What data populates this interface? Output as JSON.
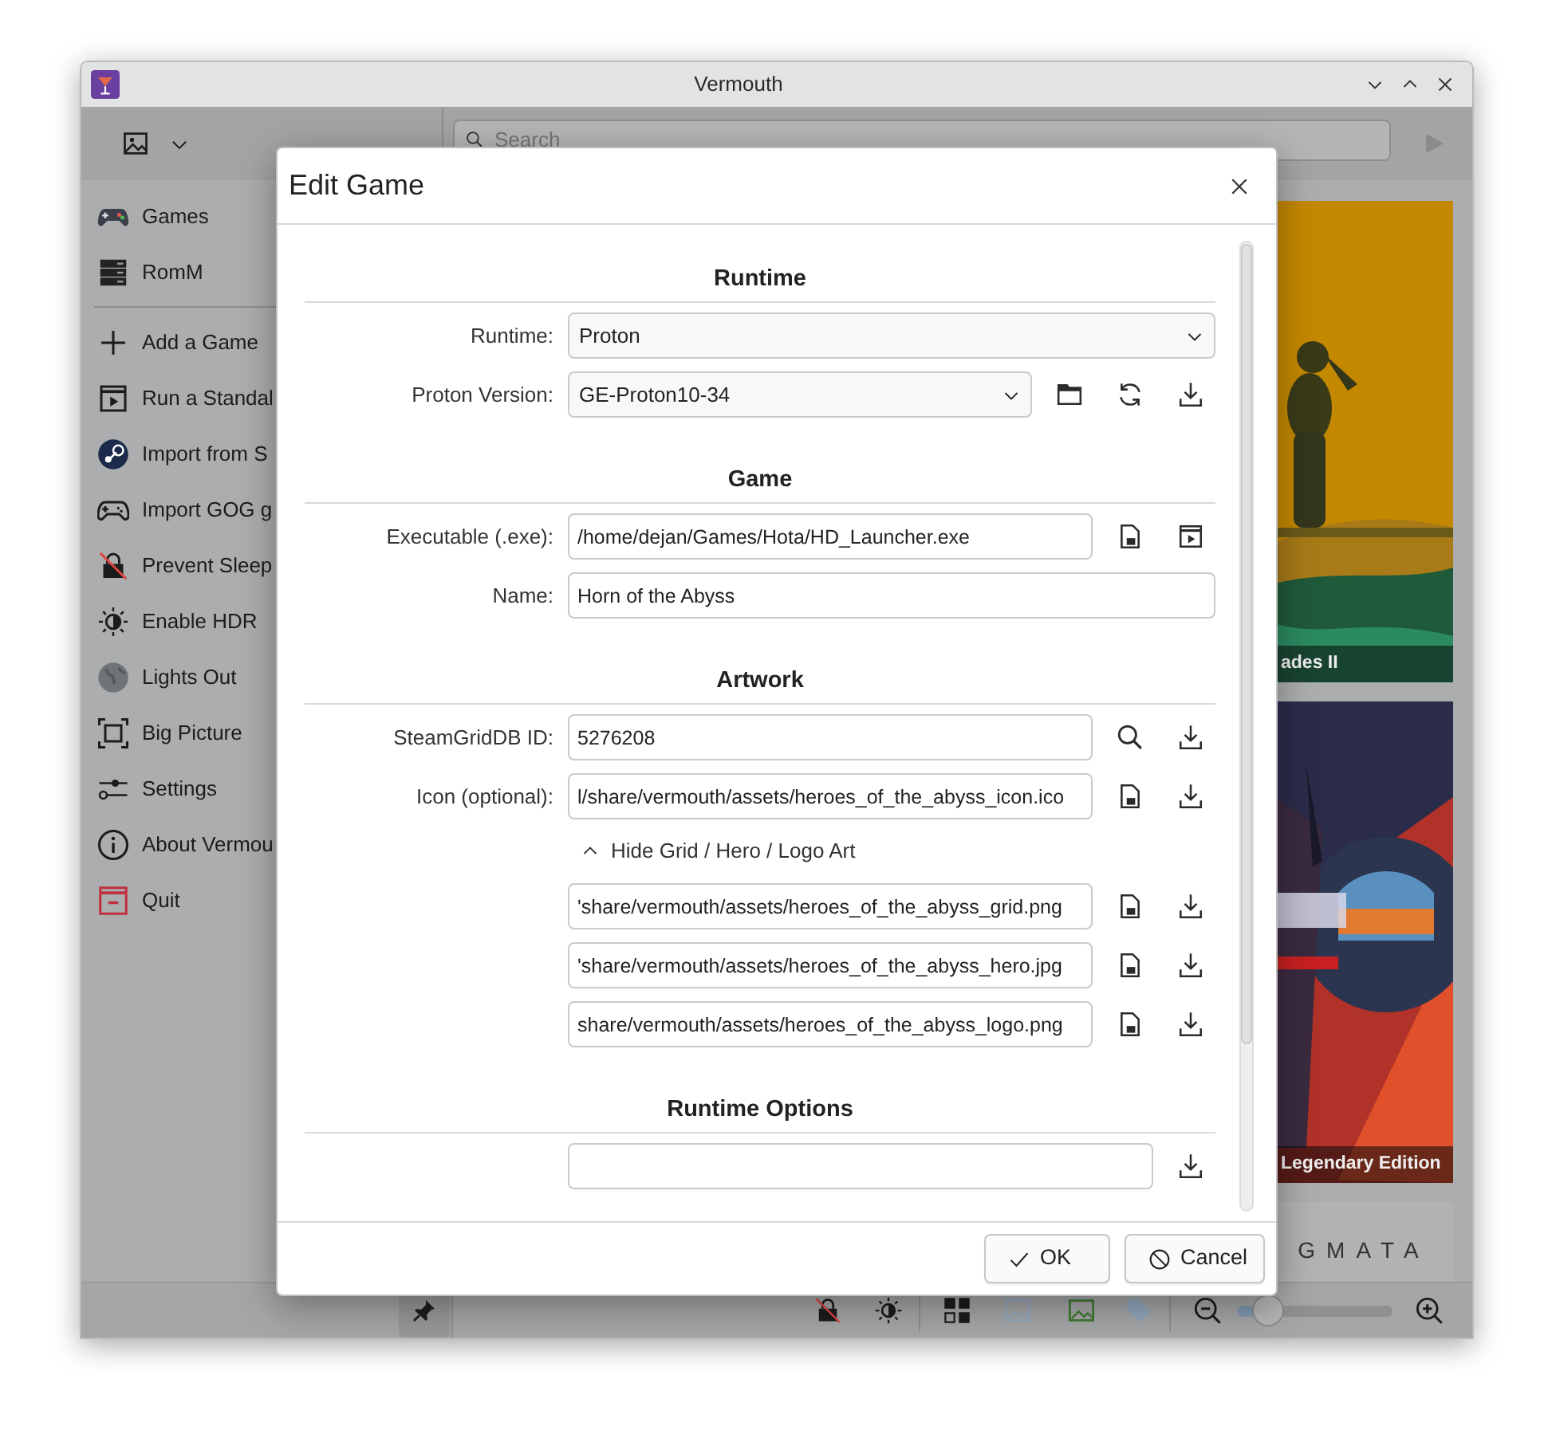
{
  "window": {
    "title": "Vermouth"
  },
  "toolbar": {
    "search": {
      "placeholder": "Search"
    }
  },
  "sidebar": {
    "groups": [
      [
        {
          "label": "Games"
        },
        {
          "label": "RomM"
        }
      ],
      [
        {
          "label": "Add a Game"
        },
        {
          "label": "Run a Standal"
        },
        {
          "label": "Import from S"
        },
        {
          "label": "Import GOG g"
        },
        {
          "label": "Prevent Sleep"
        },
        {
          "label": "Enable HDR"
        },
        {
          "label": "Lights Out"
        },
        {
          "label": "Big Picture"
        },
        {
          "label": "Settings"
        },
        {
          "label": "About Vermou"
        },
        {
          "label": "Quit"
        }
      ]
    ]
  },
  "library": {
    "covers": [
      {
        "kind": "picture",
        "caption": "ades II"
      },
      {
        "kind": "picture",
        "caption": "Legendary Edition"
      },
      {
        "kind": "text",
        "title": "GMATA"
      }
    ]
  },
  "bottom_bar": {
    "zoom": {
      "level": 0.2
    }
  },
  "dialog": {
    "title": "Edit Game",
    "sections": [
      {
        "heading": "Runtime",
        "rows": [
          {
            "kind": "select",
            "label": "Runtime:",
            "value": "Proton"
          },
          {
            "kind": "select",
            "label": "Proton Version:",
            "value": "GE-Proton10-34",
            "buttons": [
              {
                "kind": "folder"
              },
              {
                "kind": "refresh"
              },
              {
                "kind": "download"
              }
            ]
          }
        ]
      },
      {
        "heading": "Game",
        "rows": [
          {
            "kind": "input",
            "label": "Executable (.exe):",
            "value": "/home/dejan/Games/Hota/HD_Launcher.exe",
            "buttons": [
              {
                "kind": "file"
              },
              {
                "kind": "run"
              }
            ]
          },
          {
            "kind": "input",
            "label": "Name:",
            "value": "Horn of the Abyss"
          }
        ]
      },
      {
        "heading": "Artwork",
        "rows": [
          {
            "kind": "input",
            "label": "SteamGridDB ID:",
            "value": "5276208",
            "buttons": [
              {
                "kind": "search"
              },
              {
                "kind": "download"
              }
            ]
          },
          {
            "kind": "input",
            "label": "Icon (optional):",
            "value": "l/share/vermouth/assets/heroes_of_the_abyss_icon.ico",
            "buttons": [
              {
                "kind": "file"
              },
              {
                "kind": "download"
              }
            ]
          },
          {
            "kind": "toggle",
            "label": "Hide Grid / Hero / Logo Art",
            "expanded": true
          },
          {
            "kind": "input",
            "value": "'share/vermouth/assets/heroes_of_the_abyss_grid.png",
            "buttons": [
              {
                "kind": "file"
              },
              {
                "kind": "download"
              }
            ]
          },
          {
            "kind": "input",
            "value": "'share/vermouth/assets/heroes_of_the_abyss_hero.jpg",
            "buttons": [
              {
                "kind": "file"
              },
              {
                "kind": "download"
              }
            ]
          },
          {
            "kind": "input",
            "value": "share/vermouth/assets/heroes_of_the_abyss_logo.png",
            "buttons": [
              {
                "kind": "file"
              },
              {
                "kind": "download"
              }
            ]
          }
        ]
      },
      {
        "heading": "Runtime Options",
        "rows": [
          {
            "kind": "input",
            "buttons": [
              {
                "kind": "download"
              }
            ]
          }
        ]
      }
    ],
    "buttons": [
      {
        "kind": "ok",
        "label": "OK"
      },
      {
        "kind": "cancel",
        "label": "Cancel"
      }
    ]
  }
}
